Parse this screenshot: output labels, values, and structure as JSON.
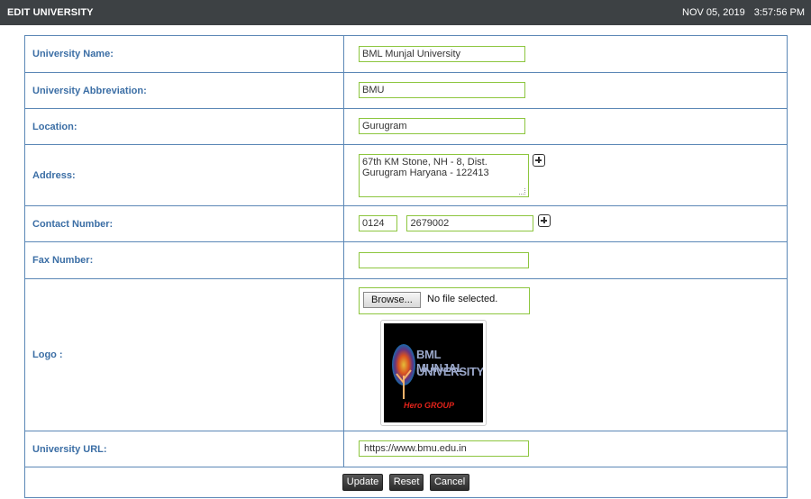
{
  "header": {
    "title": "EDIT UNIVERSITY",
    "date": "NOV 05, 2019",
    "time": "3:57:56 PM"
  },
  "form": {
    "university_name": {
      "label": "University Name:",
      "value": "BML Munjal University"
    },
    "abbreviation": {
      "label": "University Abbreviation:",
      "value": "BMU"
    },
    "location": {
      "label": "Location:",
      "value": "Gurugram"
    },
    "address": {
      "label": "Address:",
      "value": "67th KM Stone, NH - 8, Dist. Gurugram Haryana - 122413"
    },
    "contact": {
      "label": "Contact Number:",
      "code": "0124",
      "number": "2679002"
    },
    "fax": {
      "label": "Fax Number:",
      "value": ""
    },
    "logo": {
      "label": "Logo :",
      "browse_label": "Browse...",
      "file_status": "No file selected.",
      "logo_text_line1": "BML MUNJAL",
      "logo_text_line2": "UNIVERSITY",
      "logo_text_line3": "Hero GROUP"
    },
    "url": {
      "label": "University URL:",
      "value": "https://www.bmu.edu.in"
    }
  },
  "buttons": {
    "update": "Update",
    "reset": "Reset",
    "cancel": "Cancel"
  },
  "colors": {
    "header_bg": "#3d4144",
    "label_text": "#3b6ea5",
    "border": "#5b87b6",
    "input_border": "#8dc63f"
  }
}
